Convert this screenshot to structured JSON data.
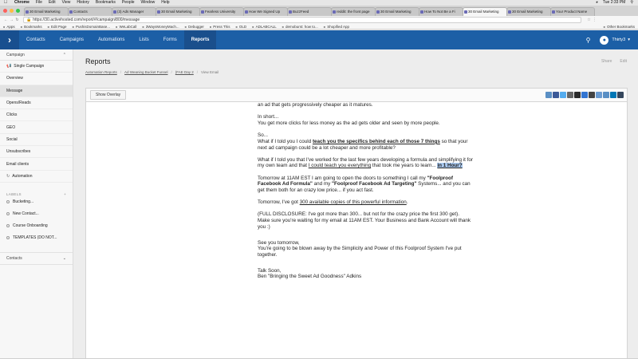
{
  "menubar": {
    "app": "Chrome",
    "items": [
      "File",
      "Edit",
      "View",
      "History",
      "Bookmarks",
      "People",
      "Window",
      "Help"
    ],
    "clock": "Tue 2:33 PM"
  },
  "tabs": [
    "30 Email Marketing",
    "Contacts",
    "(3) Ads Manager",
    "30 Email Marketing",
    "Fearless University",
    "How We Signed Up",
    "BuzzFeed",
    "reddit: the front page",
    "30 Email Marketing",
    "How To Not Be a Fi",
    "30 Email Marketing",
    "30 Email Marketing",
    "Your Product Name"
  ],
  "url": "https://30.activehosted.com/report/#/campaign/800/message",
  "bookmarks": [
    "Apps",
    "Bookmarks",
    "Edit Page",
    "PushisDomainBase...",
    "WeLabCall",
    "3WaysMoneyMach...",
    "Debugger",
    "Press This",
    "OLD",
    "ADLABCALL",
    "demoburst: how to...",
    "Shopified App"
  ],
  "bookmarks_other": "Other Bookmarks",
  "nav": {
    "items": [
      "Contacts",
      "Campaigns",
      "Automations",
      "Lists",
      "Forms",
      "Reports"
    ],
    "active": "Reports",
    "user": "Thirty3"
  },
  "sidebar": {
    "section": "Campaign",
    "items": [
      "Single Campaign",
      "Overview",
      "Message",
      "Opens/Reads",
      "Clicks",
      "GEO",
      "Social",
      "Unsubscribes",
      "Email clients",
      "Automation"
    ],
    "active_index": 2,
    "labels_title": "LABELS",
    "labels": [
      "Bucketing...",
      "New Contact...",
      "Course Onboarding",
      "TEMPLATES (DO NOT..."
    ],
    "contacts_section": "Contacts"
  },
  "page": {
    "title": "Reports",
    "actions": [
      "Share",
      "Edit"
    ],
    "crumbs": [
      "Automation Reports",
      "Ad Weaning Bucket Funnel",
      "(FAE Day 2",
      "View Email"
    ],
    "overlay_button": "Show Overlay"
  },
  "share_icons": [
    {
      "name": "print-icon",
      "color": "#5a8fc4"
    },
    {
      "name": "facebook-icon",
      "color": "#3b5998"
    },
    {
      "name": "twitter-icon",
      "color": "#55acee"
    },
    {
      "name": "email-icon",
      "color": "#666666"
    },
    {
      "name": "digg-icon",
      "color": "#2b2b2b"
    },
    {
      "name": "delicious-icon",
      "color": "#3274d1"
    },
    {
      "name": "stumbleupon-icon",
      "color": "#444444"
    },
    {
      "name": "reddit-icon",
      "color": "#6a9bd1"
    },
    {
      "name": "googleplus-icon",
      "color": "#5a8fc4"
    },
    {
      "name": "linkedin-icon",
      "color": "#0077b5"
    },
    {
      "name": "tumblr-icon",
      "color": "#35465c"
    }
  ],
  "email": {
    "p1": "an ad that gets progressively cheaper as it matures.",
    "p2a": "In short...",
    "p2b": "You get more clicks for less money as the ad gets older and seen by more people.",
    "p3a": "So...",
    "p3b": "What if I told you I could ",
    "p3link": "teach you the specifics behind each of those 7 things",
    "p3c": " so that your next ad campaign could be a lot cheaper and more profitable?",
    "p4a": "What if I told you that I've worked for the last few years developing a formula and simplifying it for my own team and that ",
    "p4link": "I could teach you everything",
    "p4b": " that took me years to learn... ",
    "p4hl": "in 1 Hour?",
    "p5a": "Tomorrow at 11AM EST I am going to open the doors to something I call my ",
    "p5b1": "\"Foolproof Facebook Ad Formula\"",
    "p5c": " and my ",
    "p5b2": "\"Foolproof Facebook Ad Targeting\"",
    "p5d": " Systems... and you can get them both for an crazy low price... if you act fast.",
    "p6a": "Tomorrow, I've got ",
    "p6link": "300 available copies of this powerful information",
    "p6b": ".",
    "p7a": "(FULL DISCLOSURE: I've got more than 300... but not for the crazy price the first 300 get).",
    "p7b": "Make sure you're waiting for my email at 11AM EST. Your Business and Bank Account will thank you :)",
    "p8a": "See you tomorrow,",
    "p8b": "You're going to be blown away by the Simplicity and Power of this Foolproof System I've put together.",
    "p9a": "Talk Soon,",
    "p9b": "Ben \"Bringing the Sweet Ad Goodness\" Adkins"
  }
}
